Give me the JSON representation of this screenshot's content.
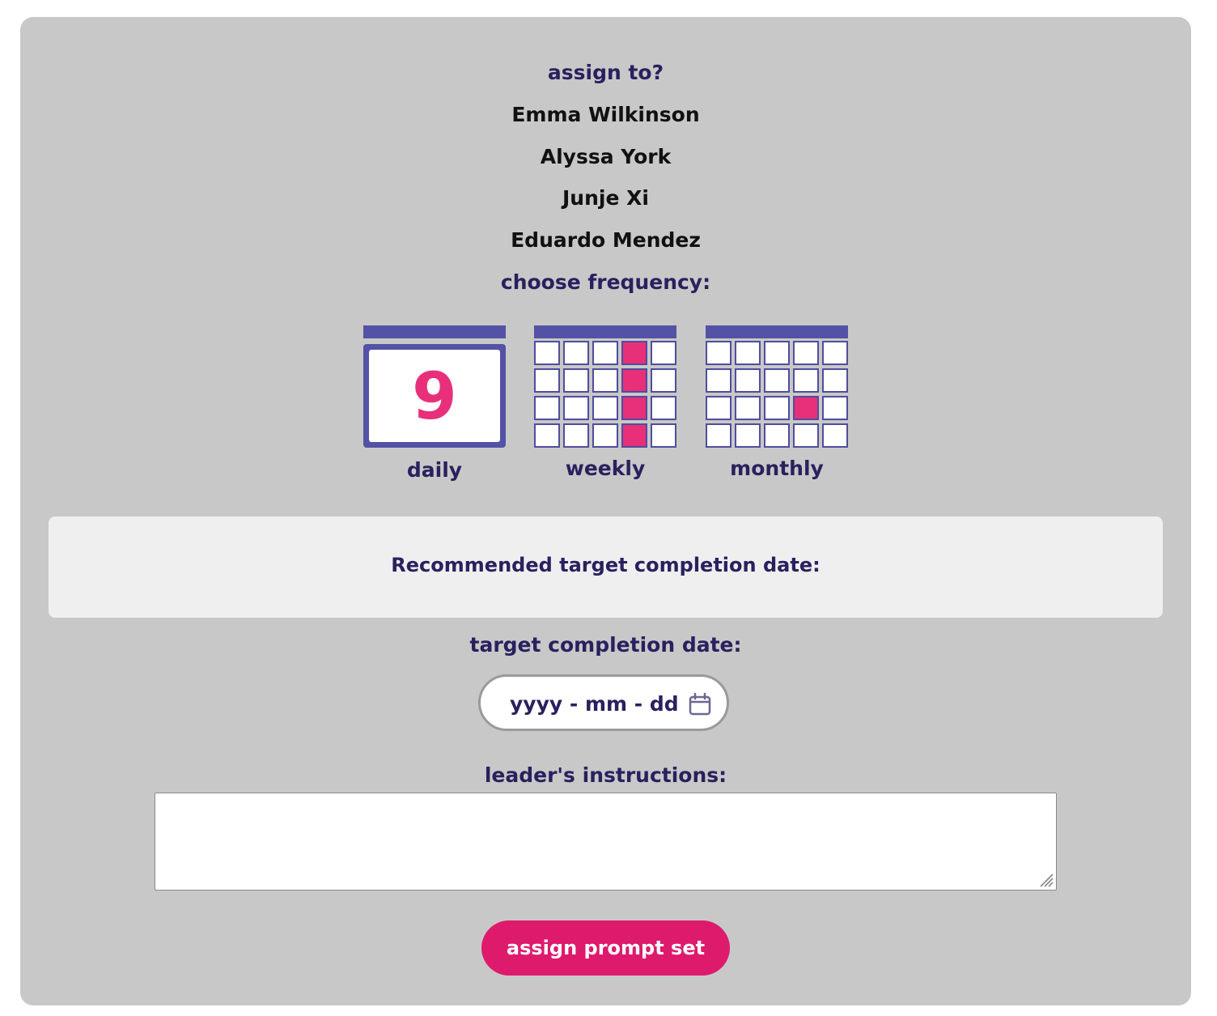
{
  "assign": {
    "heading": "assign to?",
    "members": [
      "Emma Wilkinson",
      "Alyssa York",
      "Junje Xi",
      "Eduardo Mendez"
    ]
  },
  "frequency": {
    "heading": "choose frequency:",
    "options": [
      {
        "label": "daily",
        "icon": "daily-calendar-icon",
        "day_number": "9"
      },
      {
        "label": "weekly",
        "icon": "weekly-calendar-icon"
      },
      {
        "label": "monthly",
        "icon": "monthly-calendar-icon"
      }
    ]
  },
  "recommendation": {
    "text": "Recommended target completion date:"
  },
  "target_date": {
    "label": "target completion date:",
    "placeholder": "yyyy - mm - dd",
    "icon": "calendar-icon"
  },
  "instructions": {
    "label": "leader's instructions:",
    "value": ""
  },
  "submit": {
    "label": "assign prompt set"
  },
  "colors": {
    "panel_bg": "#c8c8c8",
    "heading_text": "#29215e",
    "calendar_purple": "#5452a4",
    "highlight_pink": "#e8307a",
    "button_pink": "#de1a6c"
  }
}
